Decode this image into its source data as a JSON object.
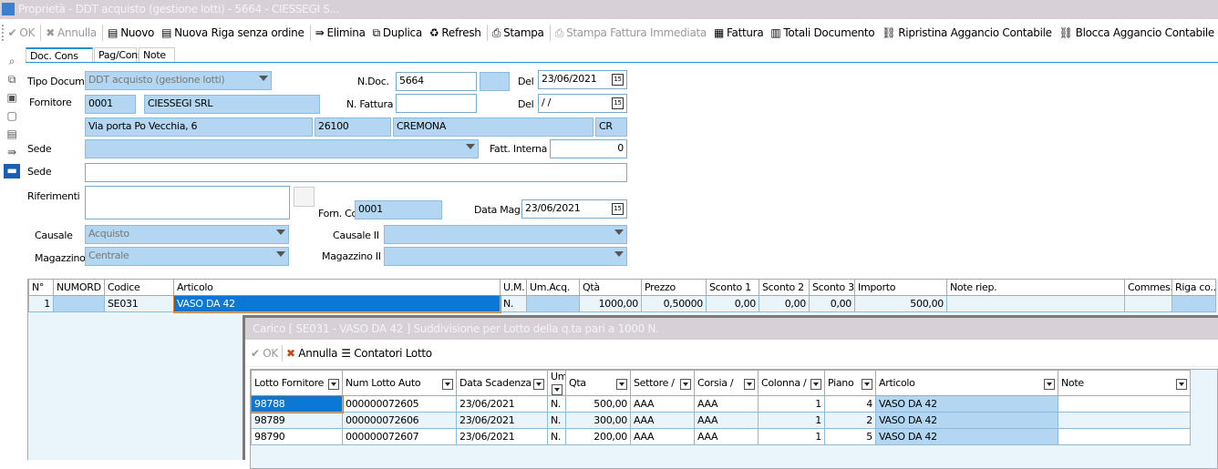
{
  "window": {
    "title": "Proprietà - DDT acquisto (gestione lotti) - 5664 - CIESSEGI S..."
  },
  "toolbar": [
    {
      "label": "OK",
      "icon": "check-icon",
      "glyph": "✔",
      "disabled": true
    },
    {
      "label": "Annulla",
      "icon": "x-icon",
      "glyph": "✖",
      "disabled": true
    },
    {
      "label": "Nuovo",
      "icon": "new-row-icon",
      "glyph": "▤",
      "disabled": false
    },
    {
      "label": "Nuova Riga senza ordine",
      "icon": "new-row-icon",
      "glyph": "▤",
      "disabled": false
    },
    {
      "label": "Elimina",
      "icon": "delete-row-icon",
      "glyph": "⇛",
      "disabled": false
    },
    {
      "label": "Duplica",
      "icon": "duplicate-icon",
      "glyph": "⧉",
      "disabled": false
    },
    {
      "label": "Refresh",
      "icon": "refresh-icon",
      "glyph": "♻",
      "disabled": false
    },
    {
      "label": "Stampa",
      "icon": "print-icon",
      "glyph": "⎙",
      "disabled": false
    },
    {
      "label": "Stampa Fattura Immediata",
      "icon": "print-icon",
      "glyph": "⎙",
      "disabled": true
    },
    {
      "label": "Fattura",
      "icon": "invoice-icon",
      "glyph": "▦",
      "disabled": false
    },
    {
      "label": "Totali Documento",
      "icon": "calculator-icon",
      "glyph": "▥",
      "disabled": false
    },
    {
      "label": "Ripristina Aggancio Contabile",
      "icon": "link-icon",
      "glyph": "⛓",
      "disabled": false
    },
    {
      "label": "Blocca Aggancio Contabile",
      "icon": "lock-link-icon",
      "glyph": "⛓",
      "disabled": false
    }
  ],
  "tabs": [
    "Doc. Cons",
    "Pag/Cons.",
    "Note"
  ],
  "form": {
    "tipo_label": "Tipo Docum.",
    "tipo_value": "DDT acquisto (gestione lotti)",
    "ndoc_label": "N.Doc.",
    "ndoc_value": "5664",
    "del_label": "Del",
    "del_value": "23/06/2021",
    "fornitore_label": "Fornitore",
    "fornitore_code": "0001",
    "fornitore_name": "CIESSEGI SRL",
    "nfattura_label": "N. Fattura",
    "nfattura_value": "",
    "del2_label": "Del",
    "del2_value": " / /",
    "address": "Via porta Po Vecchia, 6",
    "cap": "26100",
    "city": "CREMONA",
    "prov": "CR",
    "sede_label": "Sede",
    "sede_value": "",
    "fatt_label": "Fatt. Interna",
    "fatt_value": "0",
    "sede2_label": "Sede",
    "sede2_value": "",
    "rif_label": "Riferimenti",
    "rif_value": "",
    "forn_label": "Forn. Co",
    "forn_value": "0001",
    "datamag_label": "Data Mag.",
    "datamag_value": "23/06/2021",
    "causale_label": "Causale",
    "causale_value": "Acquisto",
    "causale2_label": "Causale II",
    "causale2_value": "",
    "magazzino_label": "Magazzino",
    "magazzino_value": "Centrale",
    "magazzino2_label": "Magazzino II",
    "magazzino2_value": "",
    "cal_glyph": "15"
  },
  "lines": {
    "headers": [
      "N°",
      "NUMORD",
      "Codice",
      "Articolo",
      "U.M.",
      "Um.Acq.",
      "Qtà",
      "Prezzo",
      "Sconto 1",
      "Sconto 2",
      "Sconto 3",
      "Importo",
      "Note riep.",
      "Commes...",
      "Riga co..."
    ],
    "rows": [
      [
        "1",
        "",
        "SE031",
        "VASO DA 42",
        "N.",
        "",
        "1000,00",
        "0,50000",
        "0,00",
        "0,00",
        "0,00",
        "500,00",
        "",
        "",
        ""
      ]
    ]
  },
  "dialog": {
    "title": "Carico [ SE031 - VASO DA 42 ] Suddivisione per Lotto della q.ta pari a 1000 N.",
    "ok": "OK",
    "annulla": "Annulla",
    "contatori": "Contatori Lotto",
    "headers": [
      "Lotto Fornitore",
      "Num Lotto Auto",
      "Data Scadenza",
      "Um",
      "Qta",
      "Settore /",
      "Corsia /",
      "Colonna /",
      "Piano",
      "Articolo",
      "Note"
    ],
    "rows": [
      [
        "98788",
        "000000072605",
        "23/06/2021",
        "N.",
        "500,00",
        "AAA",
        "AAA",
        "1",
        "4",
        "VASO DA 42",
        ""
      ],
      [
        "98789",
        "000000072606",
        "23/06/2021",
        "N.",
        "300,00",
        "AAA",
        "AAA",
        "1",
        "2",
        "VASO DA 42",
        ""
      ],
      [
        "98790",
        "000000072607",
        "23/06/2021",
        "N.",
        "200,00",
        "AAA",
        "AAA",
        "1",
        "5",
        "VASO DA 42",
        ""
      ]
    ]
  }
}
